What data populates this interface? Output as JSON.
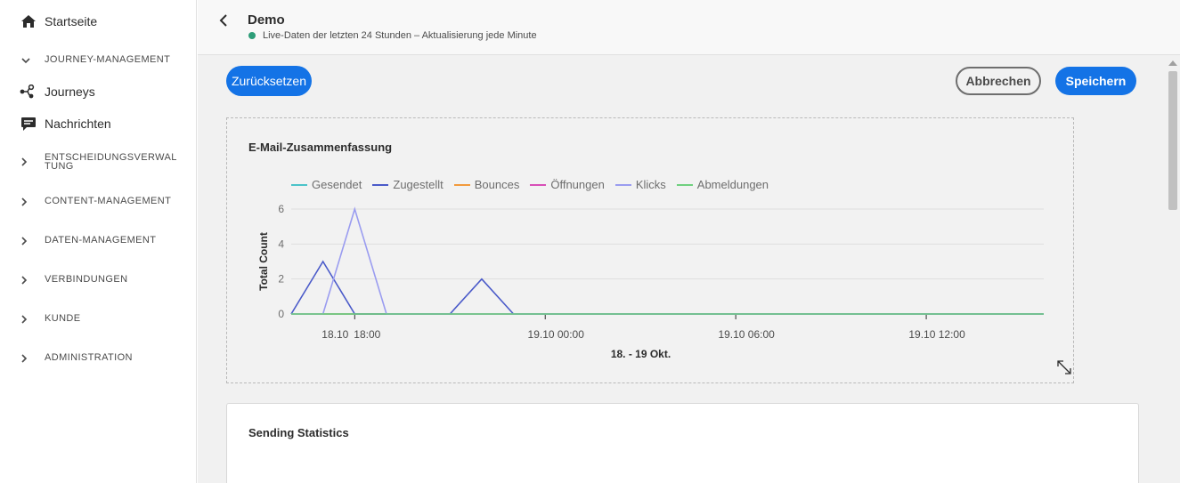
{
  "sidebar": {
    "home_label": "Startseite",
    "journey_management": "JOURNEY-MANAGEMENT",
    "journeys_label": "Journeys",
    "messages_label": "Nachrichten",
    "sections": [
      "ENTSCHEIDUNGSVERWALTUNG",
      "CONTENT-MANAGEMENT",
      "DATEN-MANAGEMENT",
      "VERBINDUNGEN",
      "KUNDE",
      "ADMINISTRATION"
    ]
  },
  "header": {
    "title": "Demo",
    "subtitle": "Live-Daten der letzten 24 Stunden – Aktualisierung jede Minute"
  },
  "toolbar": {
    "reset_label": "Zurücksetzen",
    "cancel_label": "Abbrechen",
    "save_label": "Speichern"
  },
  "cards": {
    "email_summary_title": "E-Mail-Zusammenfassung",
    "sending_stats_title": "Sending Statistics"
  },
  "colors": {
    "accent": "#1473e6",
    "live": "#2d9d78"
  },
  "chart_data": {
    "type": "line",
    "title": "",
    "xlabel": "18. - 19 Okt.",
    "ylabel": "Total Count",
    "ylim": [
      0,
      6
    ],
    "yticks": [
      0,
      2,
      4,
      6
    ],
    "xticks": [
      "18.10  18:00",
      "19.10  00:00",
      "19.10  06:00",
      "19.10  12:00"
    ],
    "xtick_hours": [
      0,
      6,
      12,
      18
    ],
    "x_start_label": "18.10",
    "grid": true,
    "legend_position": "top-left",
    "x_hours": [
      -2,
      -1,
      0,
      1,
      2,
      3,
      4,
      5,
      22
    ],
    "series": [
      {
        "name": "Gesendet",
        "color": "#4bc3c9",
        "values": [
          0,
          0,
          0,
          0,
          0,
          0,
          0,
          0,
          0
        ]
      },
      {
        "name": "Zugestellt",
        "color": "#4a5ac9",
        "values": [
          0,
          3,
          0,
          0,
          0,
          0,
          2,
          0,
          0
        ]
      },
      {
        "name": "Bounces",
        "color": "#f29a3c",
        "values": [
          0,
          0,
          0,
          0,
          0,
          0,
          0,
          0,
          0
        ]
      },
      {
        "name": "Öffnungen",
        "color": "#d84fb7",
        "values": [
          0,
          0,
          0,
          0,
          0,
          0,
          0,
          0,
          0
        ]
      },
      {
        "name": "Klicks",
        "color": "#9a9cf0",
        "values": [
          0,
          0,
          6,
          0,
          0,
          0,
          0,
          0,
          0
        ]
      },
      {
        "name": "Abmeldungen",
        "color": "#6fd07f",
        "values": [
          0,
          0,
          0,
          0,
          0,
          0,
          0,
          0,
          0
        ]
      }
    ]
  }
}
